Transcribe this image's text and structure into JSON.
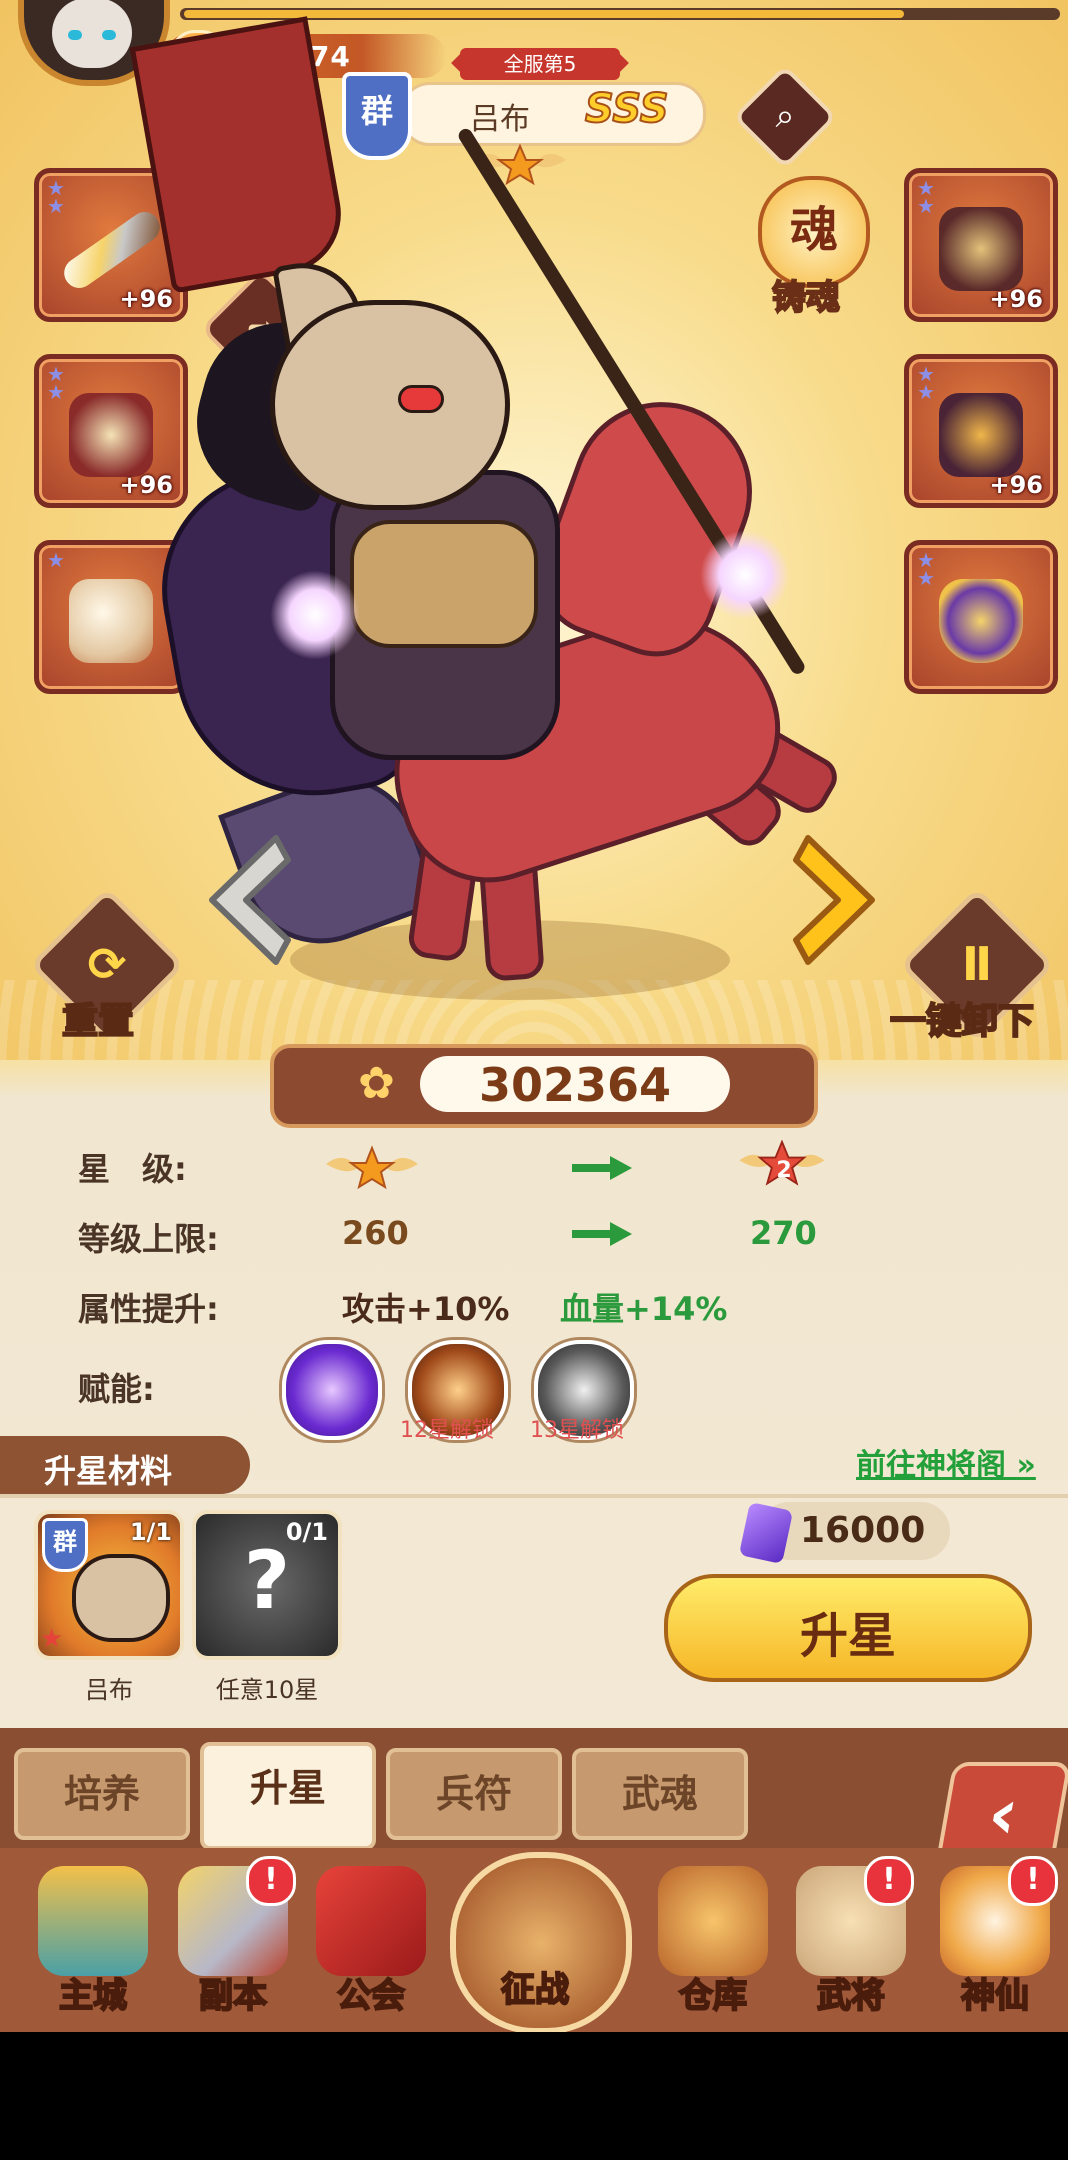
{
  "header": {
    "currency_value": "867274",
    "server_rank": "全服第5",
    "faction": "群",
    "hero_name": "吕布",
    "grade": "SSS"
  },
  "equipment": {
    "left": [
      {
        "name": "weapon",
        "level": "+96"
      },
      {
        "name": "helmet",
        "level": "+96"
      },
      {
        "name": "mount",
        "level": ""
      }
    ],
    "right": [
      {
        "name": "armor",
        "level": "+96"
      },
      {
        "name": "boots",
        "level": "+96"
      },
      {
        "name": "token",
        "level": ""
      }
    ]
  },
  "forge_label": "铸魂",
  "actions": {
    "reset_label": "重置",
    "unequip_all_label": "一键卸下"
  },
  "power": "302364",
  "stats": {
    "star_label": "星　级:",
    "star_next": "2",
    "level_cap_label": "等级上限:",
    "level_cap_current": "260",
    "level_cap_next": "270",
    "attr_label": "属性提升:",
    "attr_attack": "攻击+10%",
    "attr_hp": "血量+14%",
    "talent_label": "赋能:",
    "talent_lock_12": "12星解锁",
    "talent_lock_13": "13星解锁"
  },
  "materials": {
    "title": "升星材料",
    "goto_link": "前往神将阁",
    "items": [
      {
        "faction": "群",
        "count": "1/1",
        "label": "吕布"
      },
      {
        "count": "0/1",
        "label": "任意10星"
      }
    ],
    "cost": "16000",
    "upgrade_label": "升星"
  },
  "tabs": [
    "培养",
    "升星",
    "兵符",
    "武魂"
  ],
  "active_tab": "升星",
  "nav": [
    {
      "label": "主城",
      "badge": ""
    },
    {
      "label": "副本",
      "badge": "!"
    },
    {
      "label": "公会",
      "badge": ""
    },
    {
      "label": "征战",
      "badge": ""
    },
    {
      "label": "仓库",
      "badge": ""
    },
    {
      "label": "武将",
      "badge": "!"
    },
    {
      "label": "神仙",
      "badge": "!"
    }
  ],
  "colors": {
    "accent_gold": "#f6b627",
    "stat_green": "#2b9a3c",
    "lock_red": "#e05050",
    "nav_brown": "#a05a39"
  }
}
